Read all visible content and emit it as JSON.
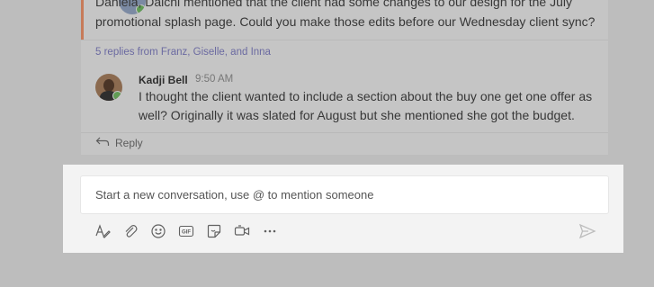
{
  "thread": {
    "message_line1": "Daniela, Daichi mentioned that the client had some changes to our design for the July",
    "message_line2": "promotional splash page. Could you make those edits before our Wednesday client sync?",
    "replies_link": "5 replies from Franz, Giselle, and Inna",
    "reply": {
      "author": "Kadji Bell",
      "time": "9:50 AM",
      "text": "I thought the client wanted to include a section about the buy one get one offer as well? Originally it was slated for August but she mentioned she got the budget."
    },
    "reply_action_label": "Reply"
  },
  "compose": {
    "placeholder": "Start a new conversation, use @ to mention someone",
    "tools": [
      "format-icon",
      "attach-icon",
      "emoji-icon",
      "gif-icon",
      "sticker-icon",
      "meet-now-icon",
      "more-options-icon"
    ],
    "send_icon": "send-icon"
  },
  "colors": {
    "background_dim": "#bdbdbd",
    "thread_card": "#c5c5c5",
    "compose_panel": "#f3f3f3",
    "accent": "#c77b5a",
    "link": "#6b6aa1",
    "presence_available": "#5f9b54"
  }
}
